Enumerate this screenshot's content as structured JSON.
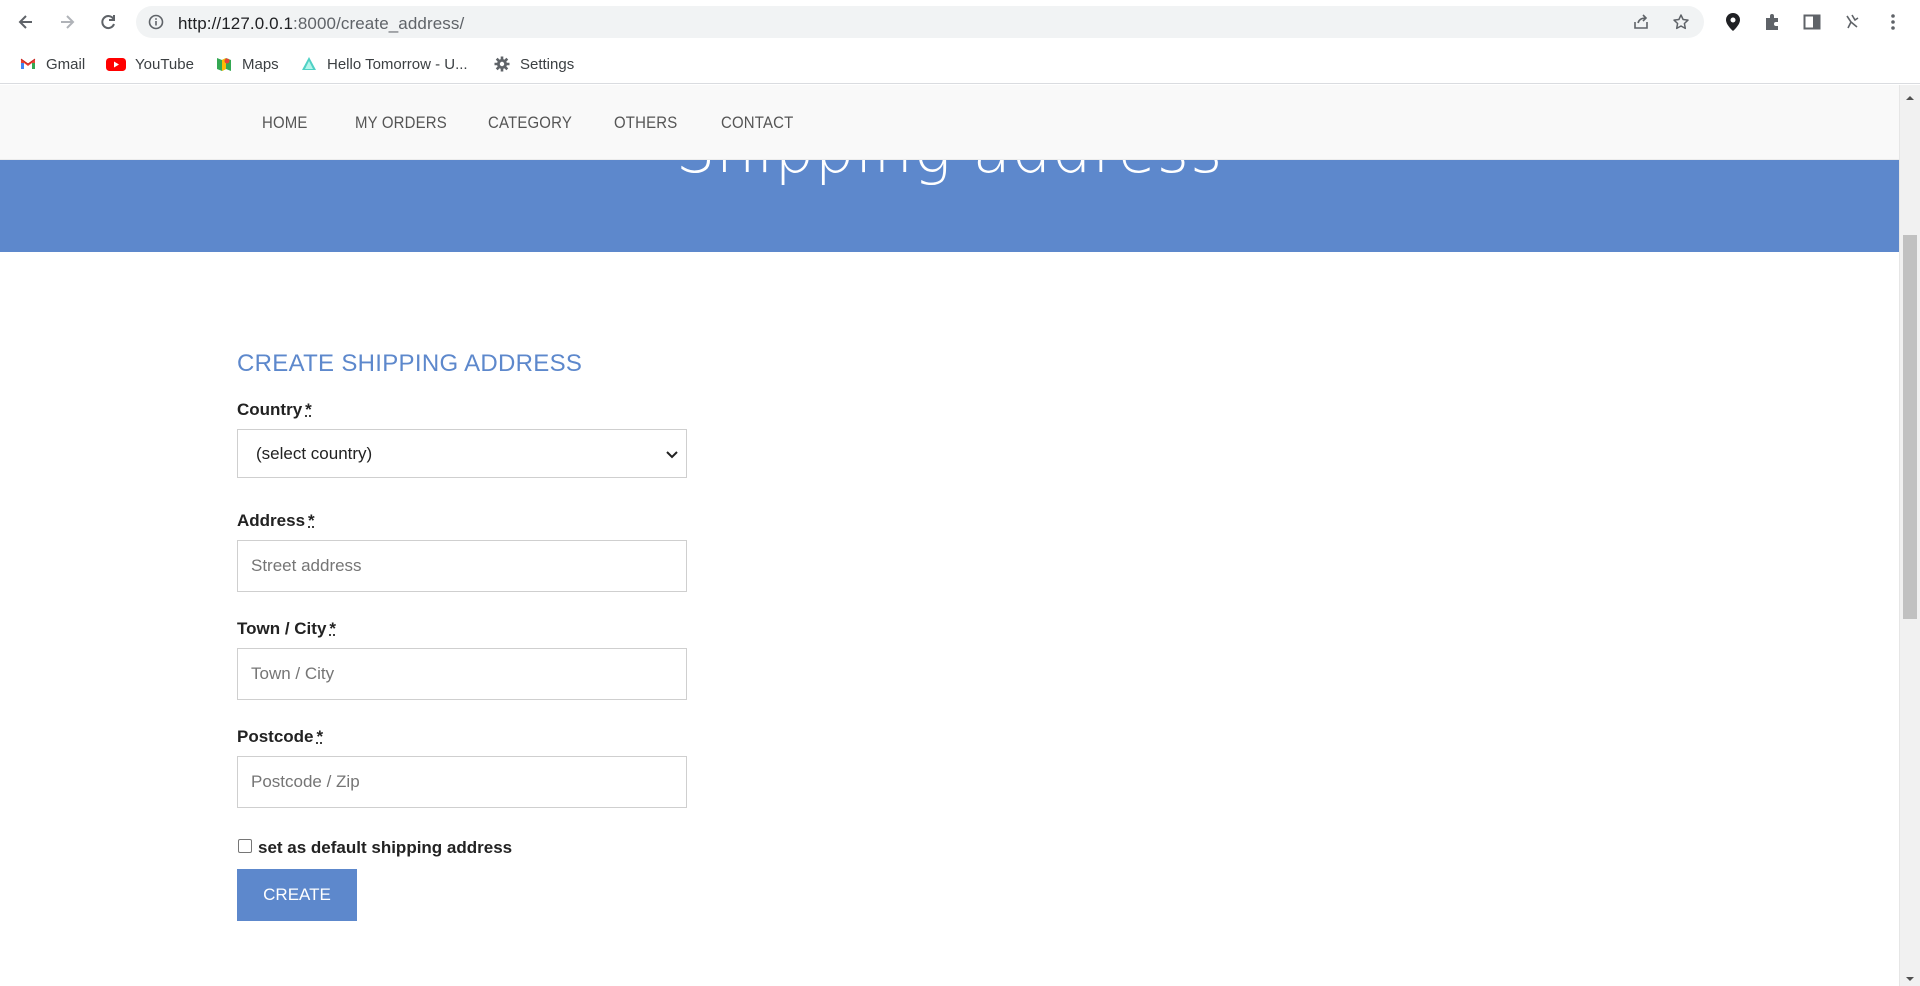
{
  "browser": {
    "url_host": "http://127.0.0.1",
    "url_path": ":8000/create_address/",
    "bookmarks": [
      {
        "label": "Gmail",
        "icon": "gmail-icon"
      },
      {
        "label": "YouTube",
        "icon": "youtube-icon"
      },
      {
        "label": "Maps",
        "icon": "maps-icon"
      },
      {
        "label": "Hello Tomorrow - U...",
        "icon": "hello-tomorrow-icon"
      },
      {
        "label": "Settings",
        "icon": "gear-icon"
      }
    ]
  },
  "site_nav": {
    "items": [
      "HOME",
      "MY ORDERS",
      "CATEGORY",
      "OTHERS",
      "CONTACT"
    ]
  },
  "hero": {
    "title": "Shipping address"
  },
  "form": {
    "title": "CREATE SHIPPING ADDRESS",
    "required_mark": "*",
    "country": {
      "label": "Country",
      "value": "(select country)"
    },
    "address": {
      "label": "Address",
      "placeholder": "Street address"
    },
    "city": {
      "label": "Town / City",
      "placeholder": "Town / City"
    },
    "postcode": {
      "label": "Postcode",
      "placeholder": "Postcode / Zip"
    },
    "default_checkbox": {
      "label": "set as default shipping address",
      "checked": false
    },
    "submit_label": "CREATE"
  },
  "colors": {
    "accent": "#5d88cc",
    "nav_bg": "#f9f9f9"
  }
}
